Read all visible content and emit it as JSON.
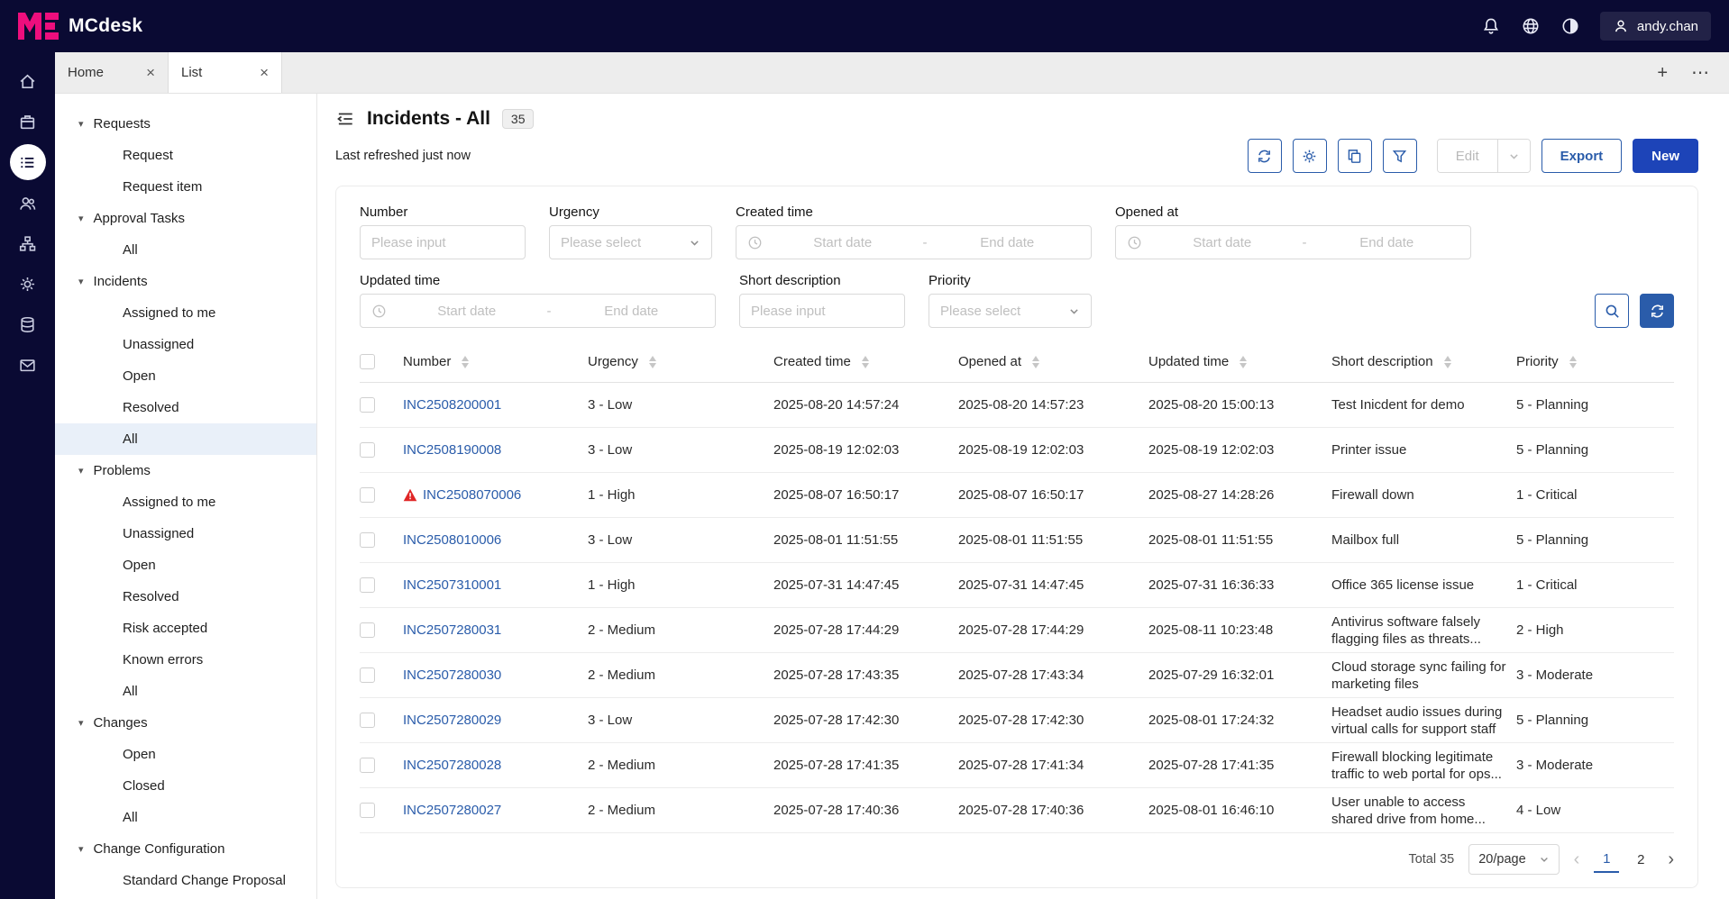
{
  "topbar": {
    "brand": "MCdesk",
    "user": "andy.chan"
  },
  "tabbar": {
    "tabs": [
      {
        "label": "Home",
        "active": false
      },
      {
        "label": "List",
        "active": true
      }
    ]
  },
  "rail": {
    "icons": [
      "home-icon",
      "tasks-icon",
      "list-icon",
      "users-icon",
      "hierarchy-icon",
      "settings-icon",
      "database-icon",
      "mail-icon"
    ],
    "active_icon": "list-icon"
  },
  "nav": {
    "items": [
      {
        "label": "Requests",
        "group": true
      },
      {
        "label": "Request",
        "child": true
      },
      {
        "label": "Request item",
        "child": true
      },
      {
        "label": "Approval Tasks",
        "group": true
      },
      {
        "label": "All",
        "child": true
      },
      {
        "label": "Incidents",
        "group": true
      },
      {
        "label": "Assigned to me",
        "child": true
      },
      {
        "label": "Unassigned",
        "child": true
      },
      {
        "label": "Open",
        "child": true
      },
      {
        "label": "Resolved",
        "child": true
      },
      {
        "label": "All",
        "child": true,
        "selected": true
      },
      {
        "label": "Problems",
        "group": true
      },
      {
        "label": "Assigned to me",
        "child": true
      },
      {
        "label": "Unassigned",
        "child": true
      },
      {
        "label": "Open",
        "child": true
      },
      {
        "label": "Resolved",
        "child": true
      },
      {
        "label": "Risk accepted",
        "child": true
      },
      {
        "label": "Known errors",
        "child": true
      },
      {
        "label": "All",
        "child": true
      },
      {
        "label": "Changes",
        "group": true
      },
      {
        "label": "Open",
        "child": true
      },
      {
        "label": "Closed",
        "child": true
      },
      {
        "label": "All",
        "child": true
      },
      {
        "label": "Change Configuration",
        "group": true
      },
      {
        "label": "Standard Change Proposal",
        "child": true
      }
    ]
  },
  "main": {
    "title": "Incidents - All",
    "count": "35",
    "refreshed": "Last refreshed just now",
    "toolbar": {
      "icons": [
        "sync-icon",
        "gear-icon",
        "copy-icon",
        "filter-icon"
      ],
      "edit": "Edit",
      "export": "Export",
      "new": "New"
    },
    "filters": {
      "number": {
        "label": "Number",
        "placeholder": "Please input"
      },
      "urgency": {
        "label": "Urgency",
        "placeholder": "Please select"
      },
      "created": {
        "label": "Created time",
        "start": "Start date",
        "separator": "-",
        "end": "End date"
      },
      "opened": {
        "label": "Opened at",
        "start": "Start date",
        "separator": "-",
        "end": "End date"
      },
      "updated": {
        "label": "Updated time",
        "start": "Start date",
        "separator": "-",
        "end": "End date"
      },
      "short_description": {
        "label": "Short description",
        "placeholder": "Please input"
      },
      "priority": {
        "label": "Priority",
        "placeholder": "Please select"
      }
    },
    "table": {
      "columns": [
        "Number",
        "Urgency",
        "Created time",
        "Opened at",
        "Updated time",
        "Short description",
        "Priority"
      ],
      "rows": [
        {
          "number": "INC2508200001",
          "urgency": "3 - Low",
          "created": "2025-08-20 14:57:24",
          "opened": "2025-08-20 14:57:23",
          "updated": "2025-08-20 15:00:13",
          "description": "Test Inicdent for demo",
          "priority": "5 - Planning",
          "alert": false
        },
        {
          "number": "INC2508190008",
          "urgency": "3 - Low",
          "created": "2025-08-19 12:02:03",
          "opened": "2025-08-19 12:02:03",
          "updated": "2025-08-19 12:02:03",
          "description": "Printer issue",
          "priority": "5 - Planning",
          "alert": false
        },
        {
          "number": "INC2508070006",
          "urgency": "1 - High",
          "created": "2025-08-07 16:50:17",
          "opened": "2025-08-07 16:50:17",
          "updated": "2025-08-27 14:28:26",
          "description": "Firewall down",
          "priority": "1 - Critical",
          "alert": true
        },
        {
          "number": "INC2508010006",
          "urgency": "3 - Low",
          "created": "2025-08-01 11:51:55",
          "opened": "2025-08-01 11:51:55",
          "updated": "2025-08-01 11:51:55",
          "description": "Mailbox full",
          "priority": "5 - Planning",
          "alert": false
        },
        {
          "number": "INC2507310001",
          "urgency": "1 - High",
          "created": "2025-07-31 14:47:45",
          "opened": "2025-07-31 14:47:45",
          "updated": "2025-07-31 16:36:33",
          "description": "Office 365 license issue",
          "priority": "1 - Critical",
          "alert": false
        },
        {
          "number": "INC2507280031",
          "urgency": "2 - Medium",
          "created": "2025-07-28 17:44:29",
          "opened": "2025-07-28 17:44:29",
          "updated": "2025-08-11 10:23:48",
          "description": "Antivirus software falsely flagging files as threats...",
          "priority": "2 - High",
          "alert": false
        },
        {
          "number": "INC2507280030",
          "urgency": "2 - Medium",
          "created": "2025-07-28 17:43:35",
          "opened": "2025-07-28 17:43:34",
          "updated": "2025-07-29 16:32:01",
          "description": "Cloud storage sync failing for marketing files",
          "priority": "3 - Moderate",
          "alert": false
        },
        {
          "number": "INC2507280029",
          "urgency": "3 - Low",
          "created": "2025-07-28 17:42:30",
          "opened": "2025-07-28 17:42:30",
          "updated": "2025-08-01 17:24:32",
          "description": "Headset audio issues during virtual calls for support staff",
          "priority": "5 - Planning",
          "alert": false
        },
        {
          "number": "INC2507280028",
          "urgency": "2 - Medium",
          "created": "2025-07-28 17:41:35",
          "opened": "2025-07-28 17:41:34",
          "updated": "2025-07-28 17:41:35",
          "description": "Firewall blocking legitimate traffic to web portal for ops...",
          "priority": "3 - Moderate",
          "alert": false
        },
        {
          "number": "INC2507280027",
          "urgency": "2 - Medium",
          "created": "2025-07-28 17:40:36",
          "opened": "2025-07-28 17:40:36",
          "updated": "2025-08-01 16:46:10",
          "description": "User unable to access shared drive from home...",
          "priority": "4 - Low",
          "alert": false
        }
      ]
    },
    "pagination": {
      "total": "Total 35",
      "page_size": "20/page",
      "pages": [
        {
          "label": "1",
          "active": true
        },
        {
          "label": "2",
          "active": false
        }
      ]
    }
  },
  "colors": {
    "topbar_bg": "#0a0a33",
    "brand_pink": "#ee0e7d",
    "link_blue": "#2a5caa",
    "primary_blue": "#1d44b8",
    "selected_nav_bg": "#e9f0f9",
    "alert_red": "#e02626"
  }
}
